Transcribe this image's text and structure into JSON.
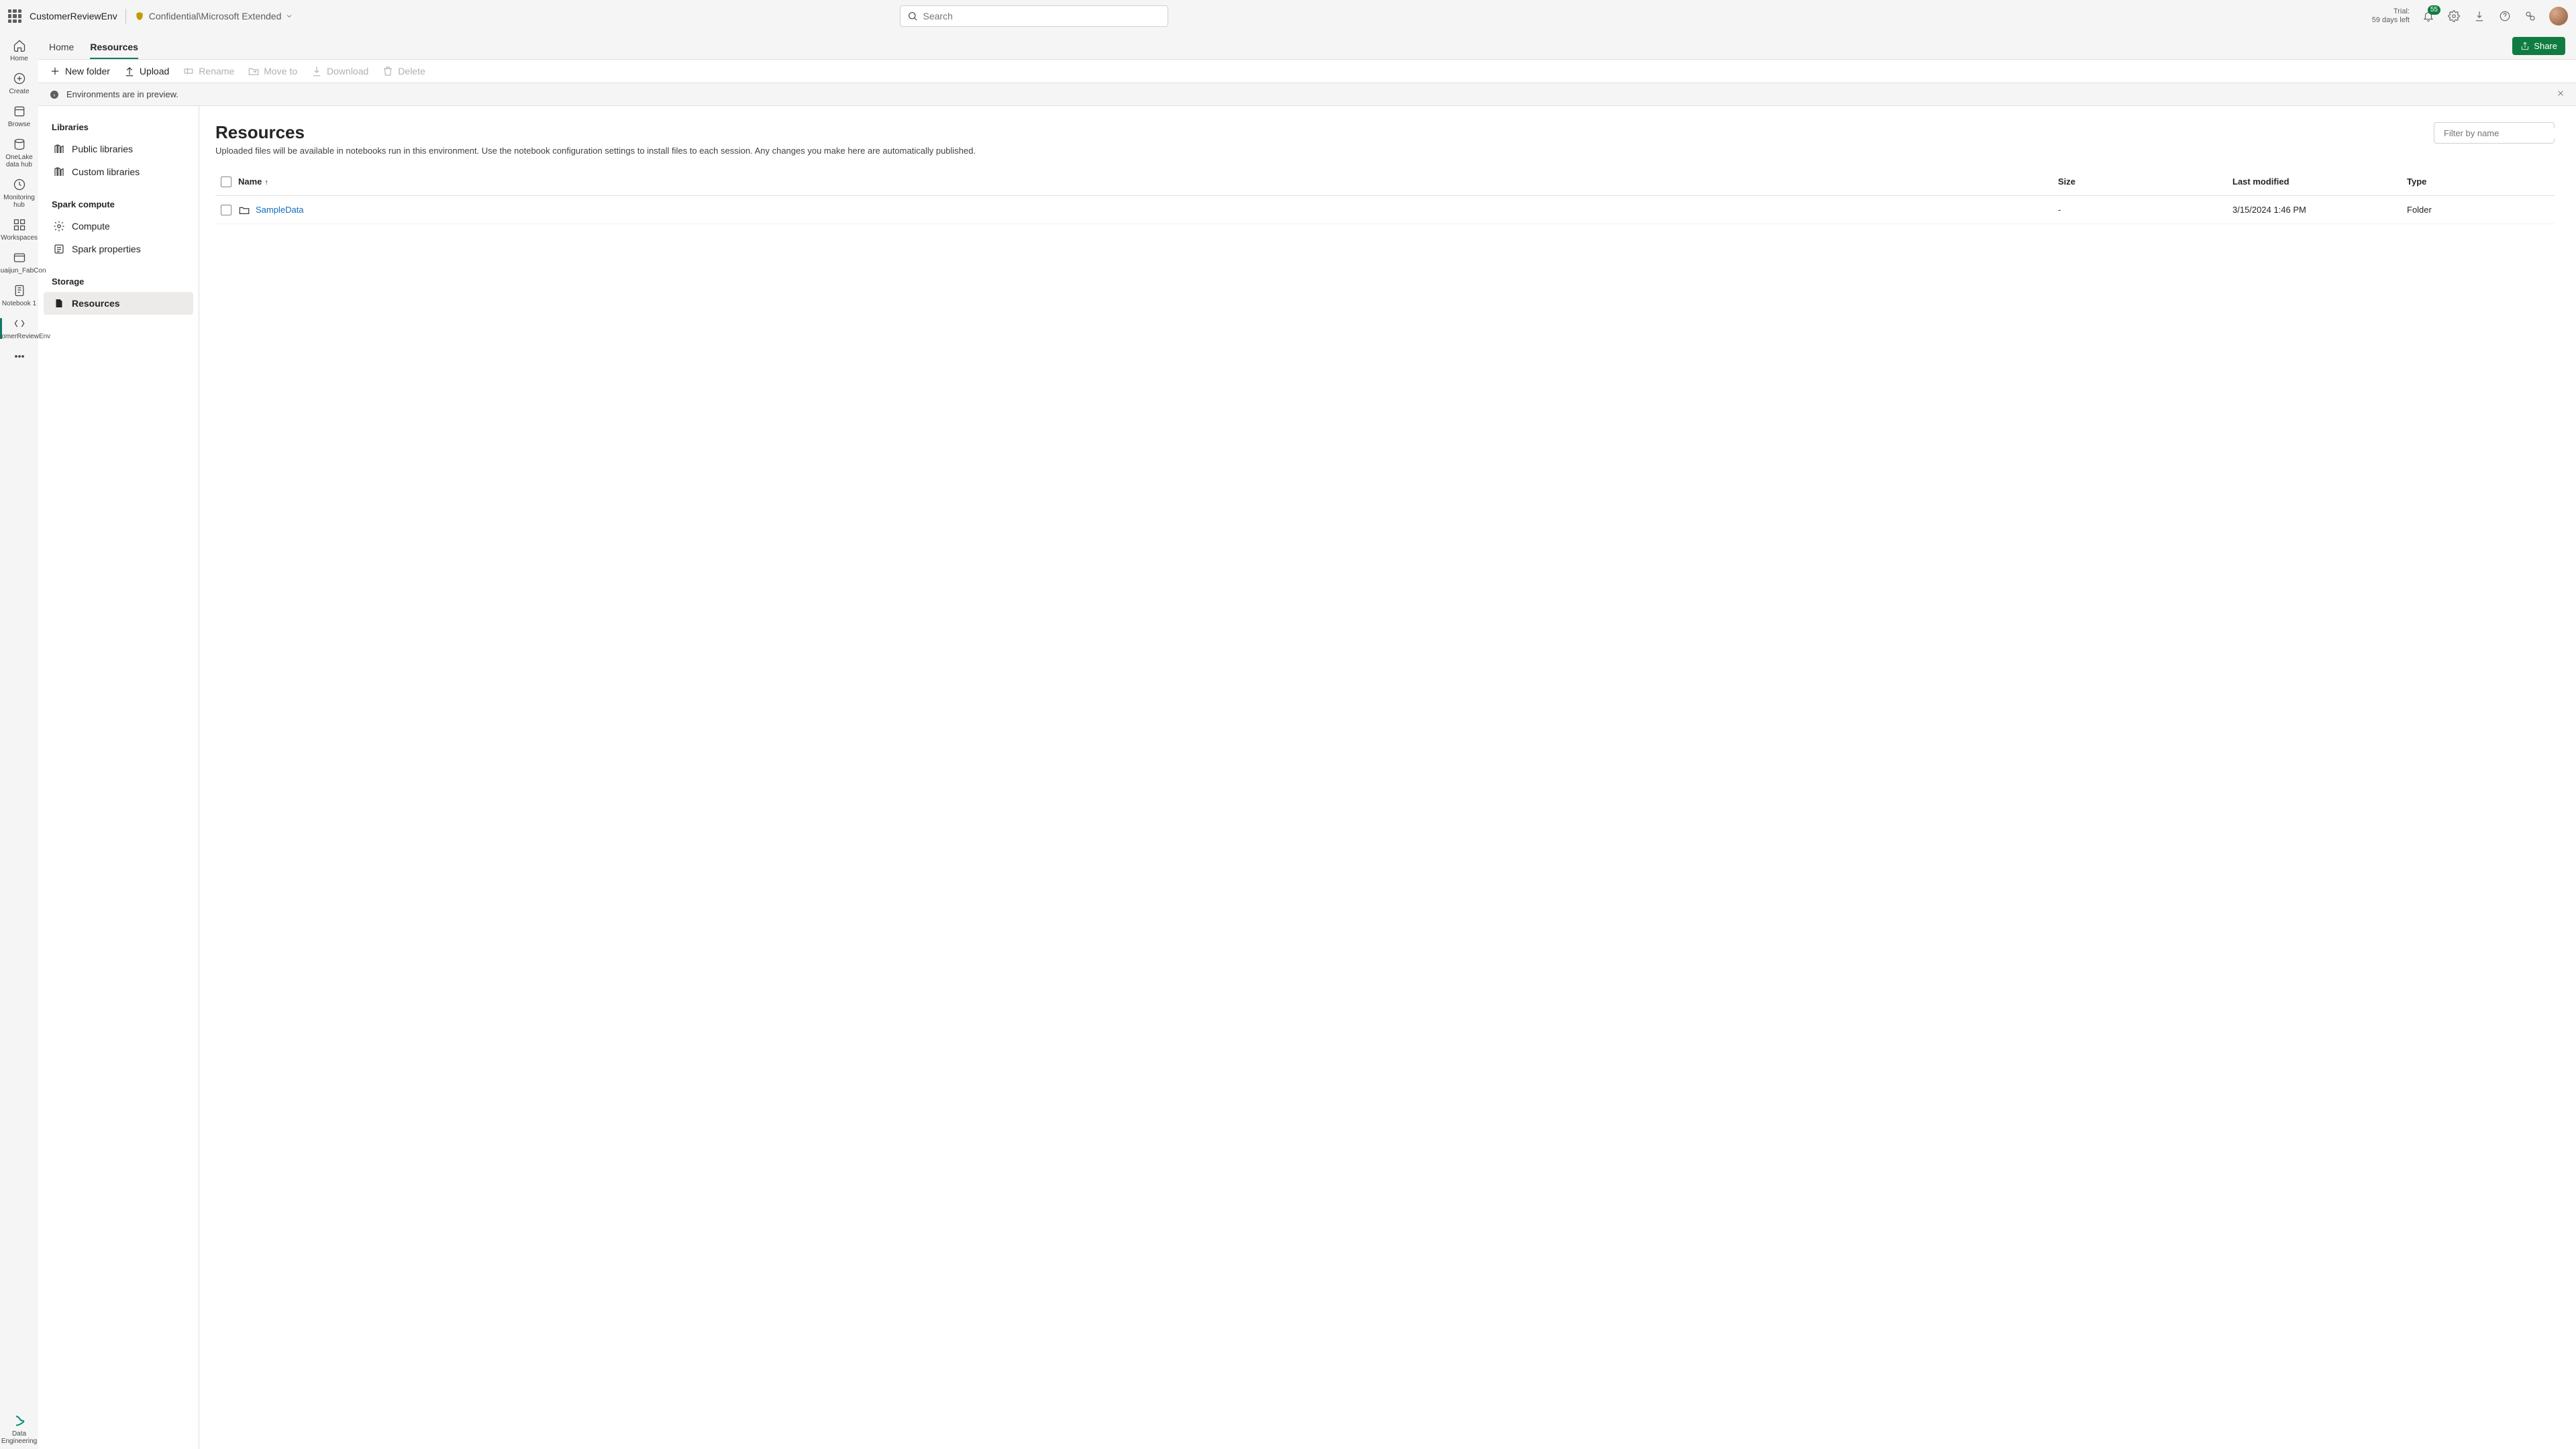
{
  "header": {
    "env_name": "CustomerReviewEnv",
    "sensitivity_label": "Confidential\\Microsoft Extended",
    "search_placeholder": "Search",
    "trial_label": "Trial:",
    "trial_remaining": "59 days left",
    "notification_count": "55",
    "share_label": "Share"
  },
  "rail": {
    "items": [
      {
        "label": "Home"
      },
      {
        "label": "Create"
      },
      {
        "label": "Browse"
      },
      {
        "label": "OneLake data hub"
      },
      {
        "label": "Monitoring hub"
      },
      {
        "label": "Workspaces"
      },
      {
        "label": "Shuaijun_FabCon"
      },
      {
        "label": "Notebook 1"
      },
      {
        "label": "CustomerReviewEnv"
      }
    ],
    "more_label": "",
    "footer_label": "Data Engineering"
  },
  "tabs": {
    "items": [
      {
        "label": "Home"
      },
      {
        "label": "Resources"
      }
    ],
    "active_index": 1
  },
  "toolbar": {
    "new_folder": "New folder",
    "upload": "Upload",
    "rename": "Rename",
    "move_to": "Move to",
    "download": "Download",
    "delete": "Delete"
  },
  "infobar": {
    "message": "Environments are in preview."
  },
  "sidebar": {
    "groups": [
      {
        "title": "Libraries",
        "items": [
          {
            "label": "Public libraries"
          },
          {
            "label": "Custom libraries"
          }
        ]
      },
      {
        "title": "Spark compute",
        "items": [
          {
            "label": "Compute"
          },
          {
            "label": "Spark properties"
          }
        ]
      },
      {
        "title": "Storage",
        "items": [
          {
            "label": "Resources"
          }
        ]
      }
    ]
  },
  "detail": {
    "title": "Resources",
    "description": "Uploaded files will be available in notebooks run in this environment. Use the notebook configuration settings to install files to each session. Any changes you make here are automatically published.",
    "filter_placeholder": "Filter by name",
    "columns": {
      "name": "Name",
      "size": "Size",
      "modified": "Last modified",
      "type": "Type"
    },
    "rows": [
      {
        "name": "SampleData",
        "size": "-",
        "modified": "3/15/2024 1:46 PM",
        "type": "Folder"
      }
    ]
  }
}
